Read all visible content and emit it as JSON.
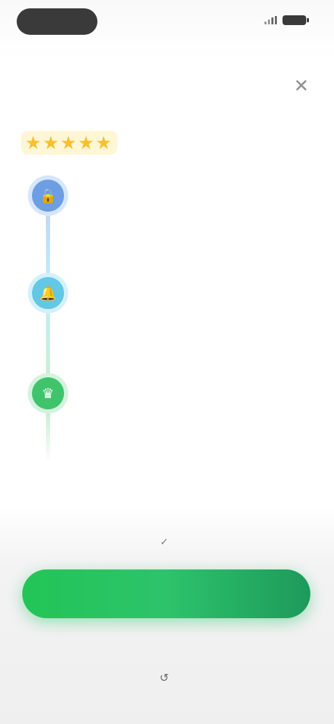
{
  "status_bar": {
    "signal_icon": "signal-icon",
    "battery_icon": "battery-icon"
  },
  "close_icon": "✕",
  "title": "",
  "rating": {
    "stars": 5,
    "star_glyph": "★",
    "count_text": "",
    "caption": ""
  },
  "steps": [
    {
      "icon": "lock-icon",
      "glyph": "🔒",
      "color": "#6d9de3",
      "title": "",
      "description": ""
    },
    {
      "icon": "bell-icon",
      "glyph": "🔔",
      "color": "#63c7e6",
      "title": "",
      "description": ""
    },
    {
      "icon": "crown-icon",
      "glyph": "♛",
      "color": "#3fc46c",
      "title": "",
      "description": ""
    }
  ],
  "footer": {
    "check_glyph": "✓",
    "caption": "",
    "cta_label": "",
    "cta_color_start": "#22c556",
    "cta_color_end": "#1d9a5a",
    "fine_print": "",
    "restore_glyph": "↺",
    "secondary_label": ""
  }
}
